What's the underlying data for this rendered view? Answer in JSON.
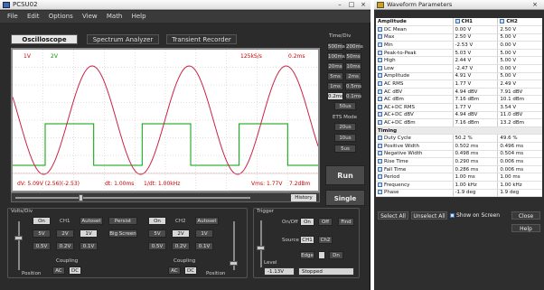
{
  "app": {
    "title": "PCSU02",
    "minimize": "–",
    "maximize": "□",
    "close": "×"
  },
  "menu": [
    "File",
    "Edit",
    "Options",
    "View",
    "Math",
    "Help"
  ],
  "tabs": [
    "Oscilloscope",
    "Spectrum Analyzer",
    "Transient Recorder"
  ],
  "scope": {
    "ch1_label": "1V",
    "ch2_label": "2V",
    "samplerate": "125kS/s",
    "timebase": "0.2ms",
    "readout_dv": "dV: 5.09V (2.56)(-2.53)",
    "readout_dt": "dt: 1.00ms",
    "readout_freq": "1/dt: 1.00kHz",
    "readout_vmax": "Vms: 1.77V",
    "readout_db": "7.2dBm"
  },
  "history_label": "History",
  "timediv": {
    "title": "Time/Div",
    "buttons": [
      "500ms",
      "200ms",
      "100ms",
      "50ms",
      "20ms",
      "10ms",
      "5ms",
      "2ms",
      "1ms",
      "0.5ms",
      "0.2ms",
      "0.1ms",
      "50us"
    ],
    "selected": "0.2ms",
    "ets_label": "ETS Mode",
    "ets_buttons": [
      "20us",
      "10us",
      "5us"
    ]
  },
  "run_label": "Run",
  "single_label": "Single",
  "ch1": {
    "title": "Volts/Div",
    "on": "On",
    "name": "CH1",
    "autoset": "Autoset",
    "volts": [
      "5V",
      "2V",
      "1V",
      "0.5V",
      "0.2V",
      "0.1V"
    ],
    "selected": "1V",
    "position": "Position",
    "coupling": "Coupling",
    "ac": "AC",
    "dc": "DC"
  },
  "middle": {
    "persist": "Persist",
    "bigscreen": "Big Screen"
  },
  "ch2": {
    "on": "On",
    "name": "CH2",
    "autoset": "Autoset",
    "volts": [
      "5V",
      "2V",
      "1V",
      "0.5V",
      "0.2V",
      "0.1V"
    ],
    "selected": "2V",
    "position": "Position",
    "coupling": "Coupling",
    "ac": "AC",
    "dc": "DC"
  },
  "trigger": {
    "title": "Trigger",
    "onoff": "On/Off",
    "on": "On",
    "off": "Off",
    "find": "Find",
    "source": "Source",
    "ch1": "CH1",
    "ch2": "Ch2",
    "edge": "Edge",
    "edge_dir": "Dn",
    "level_label": "Level",
    "level": "-1.13V",
    "status": "Stopped"
  },
  "wave": {
    "title": "Waveform Parameters",
    "col_param": "Amplitude",
    "col_ch1": "CH1",
    "col_ch2": "CH2",
    "amplitude": [
      [
        "DC Mean",
        "0.00 V",
        "2.50 V"
      ],
      [
        "Max",
        "2.50 V",
        "5.00 V"
      ],
      [
        "Min",
        "-2.53 V",
        "0.00 V"
      ],
      [
        "Peak-to-Peak",
        "5.03 V",
        "5.00 V"
      ],
      [
        "High",
        "2.44 V",
        "5.00 V"
      ],
      [
        "Low",
        "-2.47 V",
        "0.00 V"
      ],
      [
        "Amplitude",
        "4.91 V",
        "5.00 V"
      ],
      [
        "AC RMS",
        "1.77 V",
        "2.49 V"
      ],
      [
        "AC dBV",
        "4.94 dBV",
        "7.91 dBV"
      ],
      [
        "AC dBm",
        "7.16 dBm",
        "10.1 dBm"
      ],
      [
        "AC+DC RMS",
        "1.77 V",
        "3.54 V"
      ],
      [
        "AC+DC dBV",
        "4.94 dBV",
        "11.0 dBV"
      ],
      [
        "AC+DC dBm",
        "7.16 dBm",
        "13.2 dBm"
      ]
    ],
    "timing_label": "Timing",
    "timing": [
      [
        "Duty Cycle",
        "50.2 %",
        "49.6 %"
      ],
      [
        "Positive Width",
        "0.502 ms",
        "0.496 ms"
      ],
      [
        "Negative Width",
        "0.498 ms",
        "0.504 ms"
      ],
      [
        "Rise Time",
        "0.290 ms",
        "0.006 ms"
      ],
      [
        "Fall Time",
        "0.286 ms",
        "0.006 ms"
      ],
      [
        "Period",
        "1.00 ms",
        "1.00 ms"
      ],
      [
        "Frequency",
        "1.00 kHz",
        "1.00 kHz"
      ],
      [
        "Phase",
        "-1.9 deg",
        "1.9 deg"
      ]
    ],
    "select_all": "Select All",
    "unselect_all": "Unselect All",
    "show_on_screen": "Show on Screen",
    "close": "Close",
    "help": "Help"
  },
  "colors": {
    "ch1": "#cc2244",
    "ch2": "#00a000",
    "grid": "#b0b0b0"
  }
}
